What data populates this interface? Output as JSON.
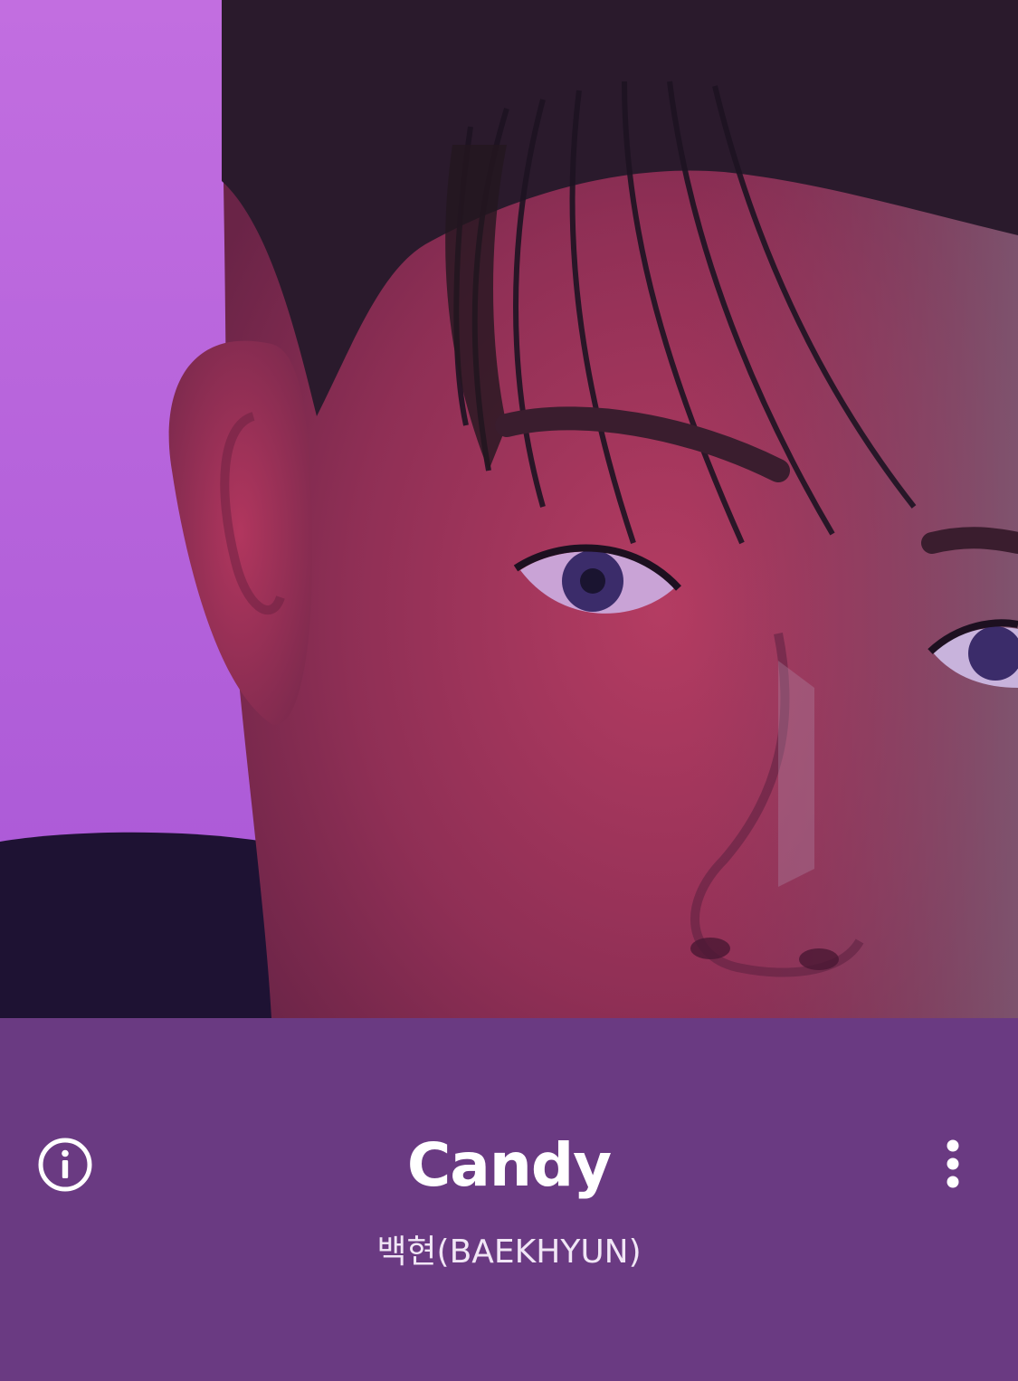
{
  "now_playing": {
    "title": "Candy",
    "artist": "백현(BAEKHYUN)"
  },
  "icons": {
    "info": "info-circle-icon",
    "more": "more-vertical-icon"
  },
  "colors": {
    "panel_background": "#6a3a82",
    "text_primary": "#ffffff",
    "text_secondary": "#f1e6f6",
    "art_background": "#b25fd6"
  }
}
